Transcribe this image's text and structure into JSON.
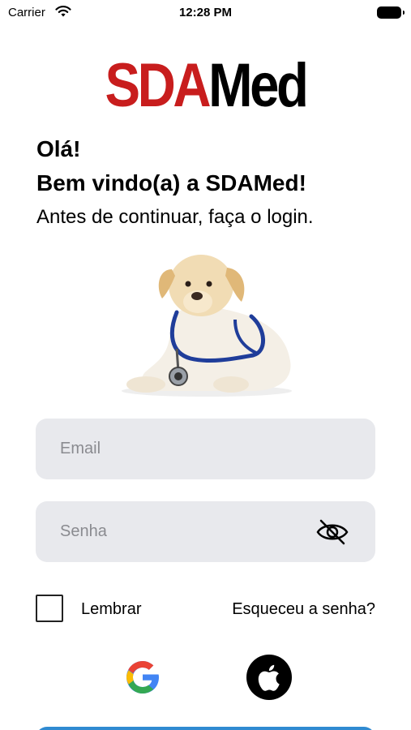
{
  "status_bar": {
    "carrier": "Carrier",
    "time": "12:28 PM"
  },
  "logo": {
    "part_red": "SDA",
    "part_black": "Med"
  },
  "header": {
    "greeting": "Olá!",
    "welcome": "Bem vindo(a) a SDAMed!",
    "subtitle": "Antes de continuar, faça o login."
  },
  "form": {
    "email_placeholder": "Email",
    "password_placeholder": "Senha",
    "remember_label": "Lembrar",
    "forgot_label": "Esqueceu a senha?",
    "remember_checked": false
  },
  "social": {
    "google_icon": "google-icon",
    "apple_icon": "apple-icon"
  },
  "colors": {
    "brand_red": "#c81d1d",
    "field_bg": "#e8e9ed",
    "primary_button": "#2f8ad1"
  }
}
